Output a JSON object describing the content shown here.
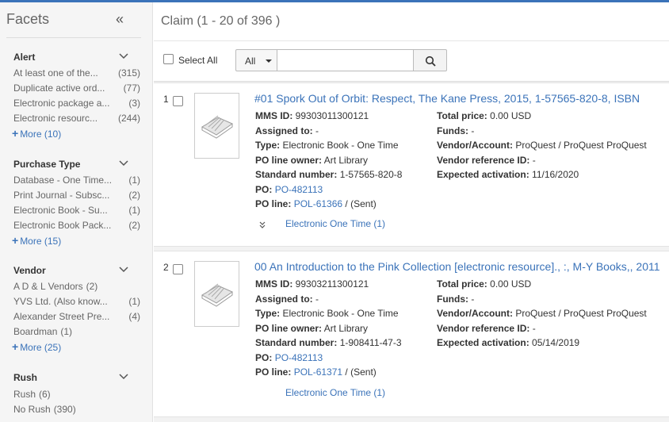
{
  "sidebar": {
    "title": "Facets",
    "groups": [
      {
        "title": "Alert",
        "items": [
          {
            "label": "At least one of the...",
            "count": "(315)"
          },
          {
            "label": "Duplicate active ord...",
            "count": "(77)"
          },
          {
            "label": "Electronic package a...",
            "count": "(3)"
          },
          {
            "label": "Electronic resourc...",
            "count": "(244)"
          }
        ],
        "more": "More (10)"
      },
      {
        "title": "Purchase Type",
        "items": [
          {
            "label": "Database - One Time...",
            "count": "(1)"
          },
          {
            "label": "Print Journal - Subsc...",
            "count": "(2)"
          },
          {
            "label": "Electronic Book - Su...",
            "count": "(1)"
          },
          {
            "label": "Electronic Book Pack...",
            "count": "(2)"
          }
        ],
        "more": "More (15)"
      },
      {
        "title": "Vendor",
        "items": [
          {
            "label": "A D & L Vendors",
            "count": "(2)"
          },
          {
            "label": "YVS Ltd. (Also know...",
            "count": "(1)"
          },
          {
            "label": "Alexander Street Pre...",
            "count": "(4)"
          },
          {
            "label": "Boardman",
            "count": "(1)"
          }
        ],
        "more": "More (25)"
      },
      {
        "title": "Rush",
        "items": [
          {
            "label": "Rush",
            "count": "(6)"
          },
          {
            "label": "No Rush",
            "count": "(390)"
          }
        ]
      }
    ]
  },
  "header": {
    "title": "Claim (1 - 20 of 396 )"
  },
  "toolbar": {
    "select_all": "Select All",
    "scope": "All",
    "search_value": ""
  },
  "results": [
    {
      "num": "1",
      "title": "#01 Spork Out of Orbit: Respect, The Kane Press, 2015, 1-57565-820-8, ISBN",
      "mms_label": "MMS ID:",
      "mms": "99303011300121",
      "assigned_label": "Assigned to:",
      "assigned": "-",
      "type_label": "Type:",
      "type": "Electronic Book - One Time",
      "owner_label": "PO line owner:",
      "owner": "Art Library",
      "std_label": "Standard number:",
      "std": "1-57565-820-8",
      "po_label": "PO:",
      "po": "PO-482113",
      "pol_label": "PO line:",
      "pol": "POL-61366",
      "pol_status": "/ (Sent)",
      "price_label": "Total price:",
      "price": "0.00 USD",
      "funds_label": "Funds:",
      "funds": "-",
      "vendor_label": "Vendor/Account:",
      "vendor": "ProQuest / ProQuest ProQuest",
      "vref_label": "Vendor reference ID:",
      "vref": "-",
      "activation_label": "Expected activation:",
      "activation": "11/16/2020",
      "sub_link": "Electronic One Time (1)"
    },
    {
      "num": "2",
      "title": "00 An Introduction to the Pink Collection [electronic resource]., :, M-Y Books,, 2011",
      "mms_label": "MMS ID:",
      "mms": "99303211300121",
      "assigned_label": "Assigned to:",
      "assigned": "-",
      "type_label": "Type:",
      "type": "Electronic Book - One Time",
      "owner_label": "PO line owner:",
      "owner": "Art Library",
      "std_label": "Standard number:",
      "std": "1-908411-47-3",
      "po_label": "PO:",
      "po": "PO-482113",
      "pol_label": "PO line:",
      "pol": "POL-61371",
      "pol_status": "/ (Sent)",
      "price_label": "Total price:",
      "price": "0.00 USD",
      "funds_label": "Funds:",
      "funds": "-",
      "vendor_label": "Vendor/Account:",
      "vendor": "ProQuest / ProQuest ProQuest",
      "vref_label": "Vendor reference ID:",
      "vref": "-",
      "activation_label": "Expected activation:",
      "activation": "05/14/2019",
      "sub_link": "Electronic One Time (1)"
    }
  ],
  "colors": {
    "accent": "#3b73b9",
    "sidebar_bg": "#f5f5f5",
    "main_bg": "#f2f2f2"
  },
  "icons": {
    "collapse": "double-chevron-left-icon",
    "facet_toggle": "chevron-down-icon",
    "more": "plus-icon",
    "search": "search-icon",
    "thumbnail": "book-placeholder-icon",
    "expand": "double-chevron-down-icon"
  }
}
